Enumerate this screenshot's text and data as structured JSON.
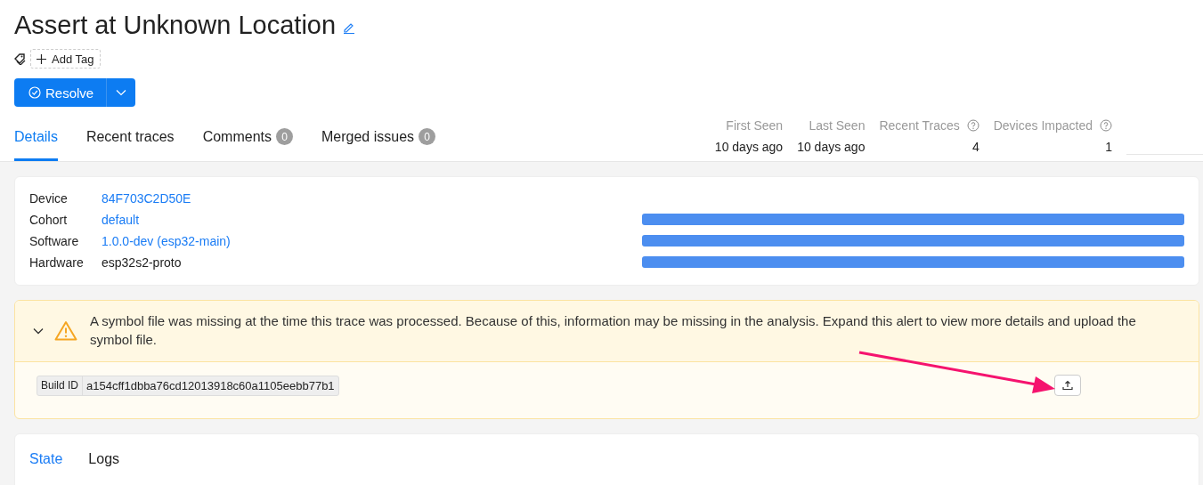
{
  "title": "Assert at Unknown Location",
  "add_tag": "Add Tag",
  "resolve_button": "Resolve",
  "tabs": [
    {
      "label": "Details",
      "selected": true
    },
    {
      "label": "Recent traces",
      "selected": false
    },
    {
      "label": "Comments",
      "count": "0",
      "selected": false
    },
    {
      "label": "Merged issues",
      "count": "0",
      "selected": false
    }
  ],
  "stats": [
    {
      "label": "First Seen",
      "value": "10 days ago",
      "help": false
    },
    {
      "label": "Last Seen",
      "value": "10 days ago",
      "help": false
    },
    {
      "label": "Recent Traces",
      "value": "4",
      "help": true
    },
    {
      "label": "Devices Impacted",
      "value": "1",
      "help": true
    }
  ],
  "device_info": [
    {
      "label": "Device",
      "value": "84F703C2D50E",
      "link": true,
      "bar": false
    },
    {
      "label": "Cohort",
      "value": "default",
      "link": true,
      "bar": true
    },
    {
      "label": "Software",
      "value": "1.0.0-dev (esp32-main)",
      "link": true,
      "bar": true
    },
    {
      "label": "Hardware",
      "value": "esp32s2-proto",
      "link": false,
      "bar": true
    }
  ],
  "alert": {
    "expanded": true,
    "message": "A symbol file was missing at the time this trace was processed. Because of this, information may be missing in the analysis. Expand this alert to view more details and upload the symbol file.",
    "build_id_label": "Build ID",
    "build_id": "a154cff1dbba76cd12013918c60a1105eebb77b1"
  },
  "bottom_tabs": [
    {
      "label": "State",
      "selected": true
    },
    {
      "label": "Logs",
      "selected": false
    }
  ]
}
